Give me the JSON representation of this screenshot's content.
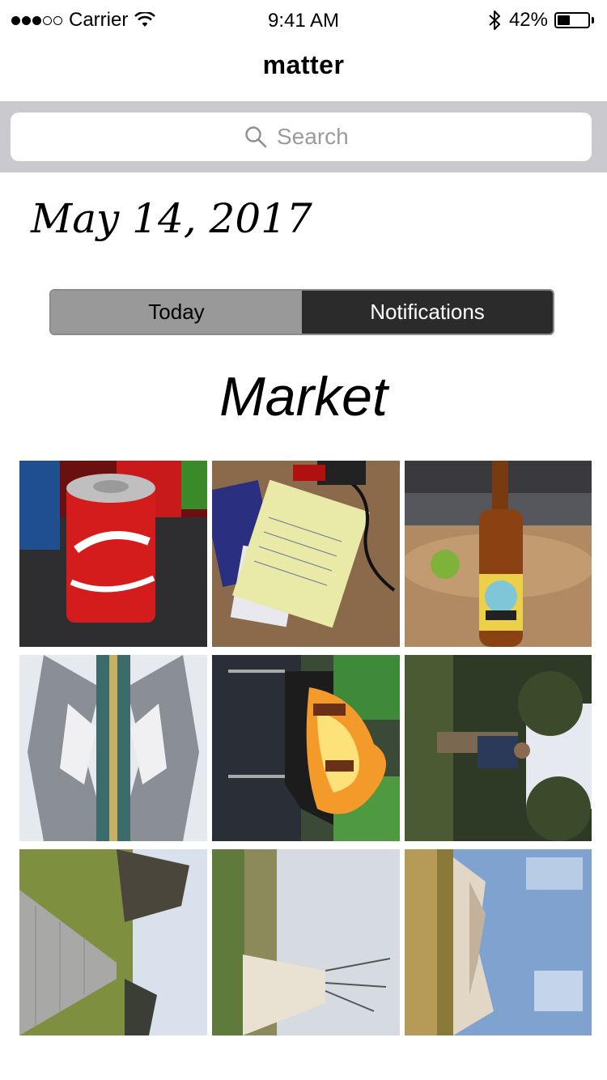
{
  "status_bar": {
    "carrier": "Carrier",
    "signal_dots": [
      true,
      true,
      true,
      false,
      false
    ],
    "time": "9:41 AM",
    "battery_percent": "42%",
    "battery_level": 0.42
  },
  "nav": {
    "title": "matter"
  },
  "search": {
    "placeholder": "Search",
    "value": ""
  },
  "date_heading": "May 14, 2017",
  "segments": {
    "items": [
      {
        "label": "Today",
        "selected": false
      },
      {
        "label": "Notifications",
        "selected": true
      }
    ]
  },
  "section": {
    "title": "Market"
  },
  "photos": [
    {
      "name": "photo-coca-cola-can",
      "icon": "soda-can"
    },
    {
      "name": "photo-desk-notes",
      "icon": "notepad"
    },
    {
      "name": "photo-beer-bottle",
      "icon": "beer-bottle"
    },
    {
      "name": "photo-mountain-lake",
      "icon": "mountain-lake"
    },
    {
      "name": "photo-campfire",
      "icon": "fire"
    },
    {
      "name": "photo-person-forest",
      "icon": "person"
    },
    {
      "name": "photo-boardwalk",
      "icon": "boardwalk"
    },
    {
      "name": "photo-teepee",
      "icon": "teepee"
    },
    {
      "name": "photo-badlands",
      "icon": "rock-formation"
    }
  ],
  "colors": {
    "search_band": "#c9c9ce",
    "segment_selected": "#2b2b2b",
    "segment_unselected": "#999999"
  }
}
